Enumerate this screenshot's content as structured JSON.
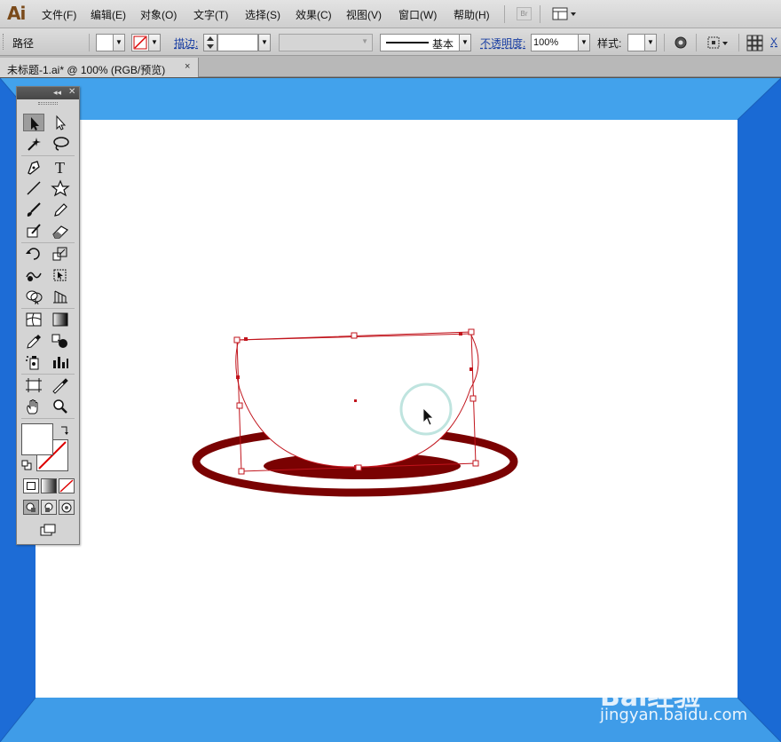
{
  "app": {
    "logo": "Ai"
  },
  "menu": [
    "文件(F)",
    "编辑(E)",
    "对象(O)",
    "文字(T)",
    "选择(S)",
    "效果(C)",
    "视图(V)",
    "窗口(W)",
    "帮助(H)"
  ],
  "bridge_label": "Br",
  "control_bar": {
    "object_label": "路径",
    "stroke_label": "描边:",
    "stroke_profile": "基本",
    "opacity_label": "不透明度:",
    "opacity_value": "100%",
    "style_label": "样式:",
    "x_label": "X"
  },
  "document_tab": {
    "title": "未标题-1.ai* @ 100% (RGB/预览)",
    "close": "×"
  },
  "colors": {
    "pasteboard_blue": "#3f9fe8",
    "pasteboard_dark": "#1f6fd8",
    "artboard": "#ffffff",
    "shape_fill": "#7a0202",
    "selection": "#c1141c",
    "cursor_highlight": "#bfe4df"
  },
  "tools": [
    "selection-tool",
    "direct-selection-tool",
    "magic-wand-tool",
    "lasso-tool",
    "pen-tool",
    "type-tool",
    "line-segment-tool",
    "star-tool",
    "paintbrush-tool",
    "pencil-tool",
    "blob-brush-tool",
    "eraser-tool",
    "rotate-tool",
    "scale-tool",
    "warp-tool",
    "free-transform-tool",
    "shape-builder-tool",
    "perspective-grid-tool",
    "mesh-tool",
    "gradient-tool",
    "eyedropper-tool",
    "blend-tool",
    "symbol-sprayer-tool",
    "column-graph-tool",
    "artboard-tool",
    "slice-tool",
    "hand-tool",
    "zoom-tool"
  ],
  "watermark": {
    "brand": "Bai经验",
    "url": "jingyan.baidu.com"
  }
}
